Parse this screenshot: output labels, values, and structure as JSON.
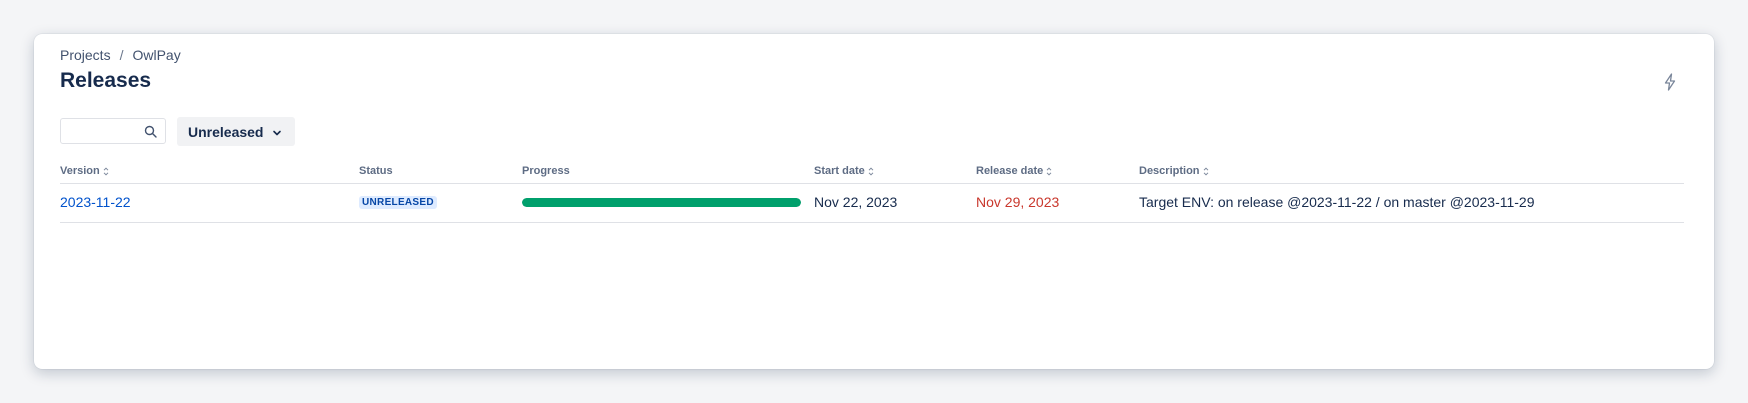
{
  "breadcrumb": {
    "items": [
      "Projects",
      "OwlPay"
    ],
    "separator": "/"
  },
  "page": {
    "title": "Releases",
    "action_icon": "lightning-bolt-icon"
  },
  "search": {
    "value": "",
    "placeholder": "",
    "icon": "search-icon"
  },
  "filter": {
    "selected": "Unreleased",
    "icon": "chevron-down-icon"
  },
  "table": {
    "columns": [
      {
        "label": "Version",
        "sortable": true
      },
      {
        "label": "Status",
        "sortable": false
      },
      {
        "label": "Progress",
        "sortable": false
      },
      {
        "label": "Start date",
        "sortable": true
      },
      {
        "label": "Release date",
        "sortable": true
      },
      {
        "label": "Description",
        "sortable": true
      }
    ],
    "rows": [
      {
        "version": "2023-11-22",
        "status": "UNRELEASED",
        "progress": 1.0,
        "start_date": "Nov 22, 2023",
        "release_date": "Nov 29, 2023",
        "description": "Target ENV: on release @2023-11-22 / on master @2023-11-29"
      }
    ]
  },
  "colors": {
    "link": "#0052cc",
    "overdue_date": "#c9372c",
    "progress_done": "#00a06c",
    "lozenge_bg": "#deebff",
    "lozenge_text": "#0747a6"
  }
}
